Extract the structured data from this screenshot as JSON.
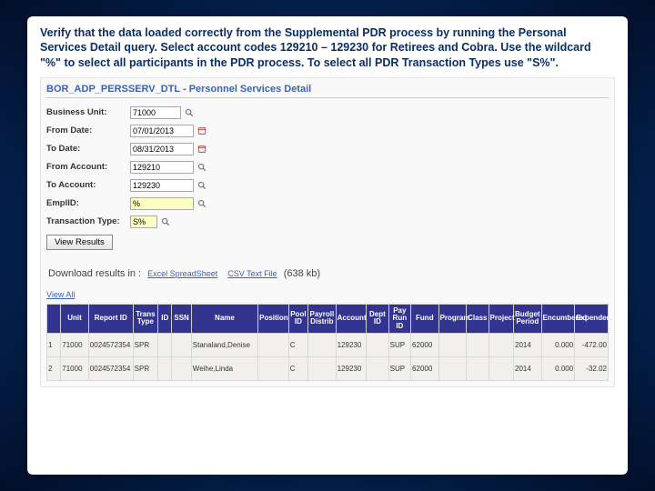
{
  "instruction": "Verify that the data loaded correctly from the Supplemental PDR process by running the Personal Services Detail query. Select account codes 129210 – 129230 for Retirees and Cobra. Use the wildcard \"%\" to select all participants in the PDR process. To select all PDR Transaction Types use \"S%\".",
  "app_title": "BOR_ADP_PERSSERV_DTL - Personnel Services Detail",
  "form": {
    "business_unit": {
      "label": "Business Unit:",
      "value": "71000"
    },
    "from_date": {
      "label": "From Date:",
      "value": "07/01/2013"
    },
    "to_date": {
      "label": "To Date:",
      "value": "08/31/2013"
    },
    "from_account": {
      "label": "From Account:",
      "value": "129210"
    },
    "to_account": {
      "label": "To Account:",
      "value": "129230"
    },
    "emplid": {
      "label": "EmplID:",
      "value": "%"
    },
    "trans_type": {
      "label": "Transaction Type:",
      "value": "S%"
    }
  },
  "view_results": "View Results",
  "download": {
    "prefix": "Download results in :",
    "excel": "Excel SpreadSheet",
    "csv": "CSV Text File",
    "size": "(638 kb)"
  },
  "view_all": "View All",
  "columns": [
    "",
    "Unit",
    "Report ID",
    "Trans Type",
    "ID",
    "SSN",
    "Name",
    "Position",
    "Pool ID",
    "Payroll Distrib",
    "Account",
    "Dept ID",
    "Pay Run ID",
    "Fund",
    "Program",
    "Class",
    "Project",
    "Budget Period",
    "Encumbered",
    "Expended"
  ],
  "rows": [
    {
      "n": "1",
      "unit": "71000",
      "report": "0024572354",
      "type": "SPR",
      "id": "",
      "ssn": "",
      "name": "Stanaland,Denise",
      "position": "",
      "pool": "C",
      "payroll": "",
      "account": "129230",
      "dept": "",
      "payrun": "SUP",
      "fund": "62000",
      "program": "",
      "class": "",
      "project": "",
      "budget": "2014",
      "enc": "0.000",
      "exp": "-472.00"
    },
    {
      "n": "2",
      "unit": "71000",
      "report": "0024572354",
      "type": "SPR",
      "id": "",
      "ssn": "",
      "name": "Weihe,Linda",
      "position": "",
      "pool": "C",
      "payroll": "",
      "account": "129230",
      "dept": "",
      "payrun": "SUP",
      "fund": "62000",
      "program": "",
      "class": "",
      "project": "",
      "budget": "2014",
      "enc": "0.000",
      "exp": "-32.02"
    }
  ]
}
